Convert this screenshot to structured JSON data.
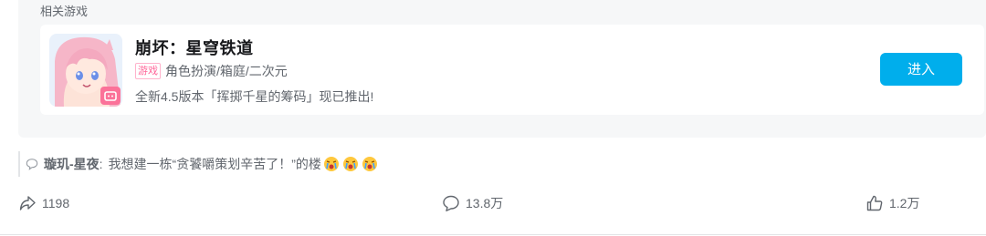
{
  "related": {
    "title": "相关游戏",
    "game": {
      "name": "崩坏：星穹铁道",
      "tag_badge": "游戏",
      "genres": "角色扮演/箱庭/二次元",
      "description": "全新4.5版本「挥掷千星的筹码」现已推出!",
      "enter_label": "进入"
    }
  },
  "top_comment": {
    "user": "璇玑-星夜",
    "separator": ":",
    "text": "我想建一栋“贪饕嚼策划辛苦了！”的楼"
  },
  "actions": {
    "forward_count": "1198",
    "comment_count": "13.8万",
    "like_count": "1.2万"
  },
  "colors": {
    "accent": "#00aeec",
    "tag_pink": "#ff6699",
    "muted_text": "#61666d",
    "panel_bg": "#f6f7f8"
  }
}
